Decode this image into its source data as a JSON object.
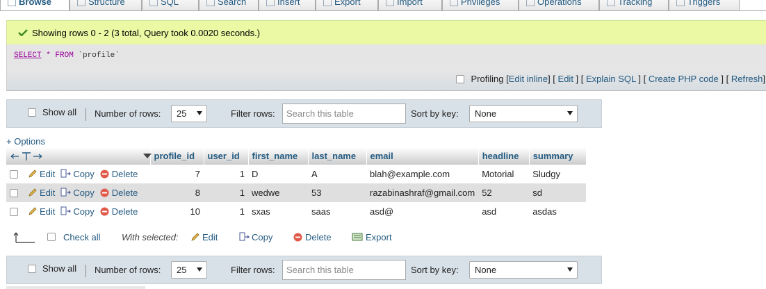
{
  "tabs": [
    {
      "label": "Browse",
      "active": true
    },
    {
      "label": "Structure"
    },
    {
      "label": "SQL"
    },
    {
      "label": "Search"
    },
    {
      "label": "Insert"
    },
    {
      "label": "Export"
    },
    {
      "label": "Import"
    },
    {
      "label": "Privileges"
    },
    {
      "label": "Operations"
    },
    {
      "label": "Tracking"
    },
    {
      "label": "Triggers"
    }
  ],
  "message": {
    "text": "Showing rows 0 - 2 (3 total, Query took 0.0020 seconds.)",
    "color": "#ebf8a4"
  },
  "sql": {
    "select": "SELECT",
    "star": " * ",
    "from": "FROM",
    "table": " `profile`"
  },
  "sql_links": {
    "profiling": "Profiling",
    "edit_inline": "Edit inline",
    "edit": "Edit",
    "explain": "Explain SQL",
    "php": "Create PHP code",
    "refresh": "Refresh"
  },
  "nav": {
    "show_all": "Show all",
    "number_of_rows_label": "Number of rows:",
    "number_of_rows_value": "25",
    "filter_label": "Filter rows:",
    "filter_placeholder": "Search this table",
    "sort_label": "Sort by key:",
    "sort_value": "None"
  },
  "options_label": "+ Options",
  "table": {
    "columns": [
      "profile_id",
      "user_id",
      "first_name",
      "last_name",
      "email",
      "headline",
      "summary"
    ],
    "row_actions": {
      "edit": "Edit",
      "copy": "Copy",
      "delete": "Delete"
    },
    "rows": [
      [
        "7",
        "1",
        "D",
        "A",
        "blah@example.com",
        "Motorial",
        "Sludgy"
      ],
      [
        "8",
        "1",
        "wedwe",
        "53",
        "razabinashraf@gmail.com",
        "52",
        "sd"
      ],
      [
        "10",
        "1",
        "sxas",
        "saas",
        "asd@",
        "asd",
        "asdas"
      ]
    ]
  },
  "with_selected": {
    "check_all": "Check all",
    "label": "With selected:",
    "edit": "Edit",
    "copy": "Copy",
    "delete": "Delete",
    "export": "Export"
  },
  "colors": {
    "link": "#235a81",
    "nav_bg": "#d9e1e8",
    "row_alt": "#dfdfdf"
  }
}
